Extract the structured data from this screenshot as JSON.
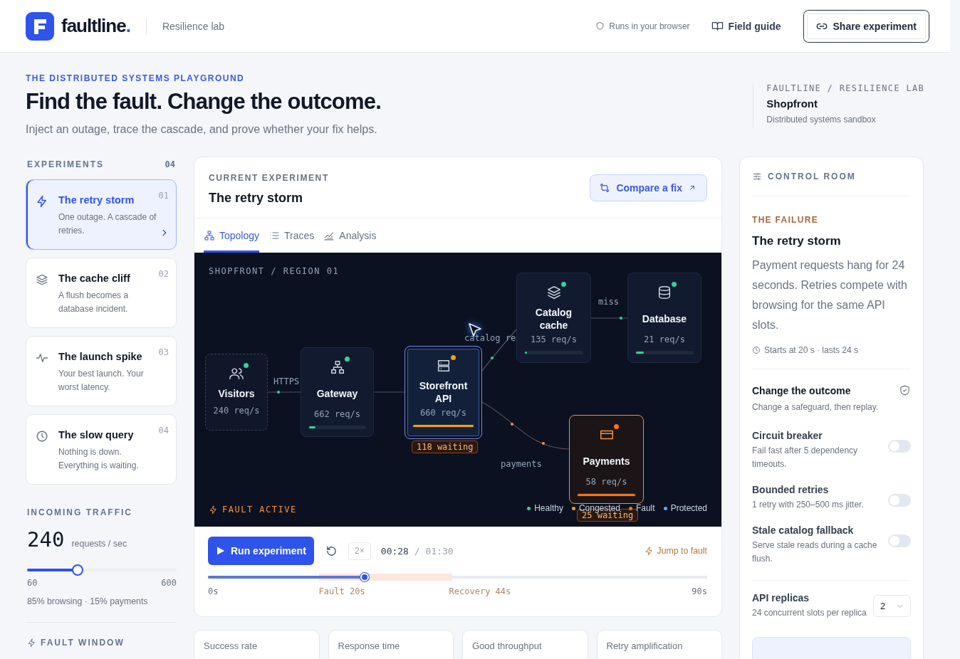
{
  "header": {
    "brand": {
      "name": "faultline",
      "mark": "."
    },
    "subtitle": "Resilience lab",
    "badge": "Runs in your browser",
    "guide_link": "Field guide",
    "share_button": "Share experiment"
  },
  "hero": {
    "eyebrow": "THE DISTRIBUTED SYSTEMS PLAYGROUND",
    "title": "Find the fault. Change the outcome.",
    "subtitle": "Inject an outage, trace the cascade, and prove whether your fix helps.",
    "meta": {
      "path": "FAULTLINE / RESILIENCE LAB",
      "name": "Shopfront",
      "caption": "Distributed systems sandbox"
    }
  },
  "experiments": {
    "heading": "EXPERIMENTS",
    "count": "04",
    "items": [
      {
        "kind": "bolt",
        "title": "The retry storm",
        "description": "One outage. A cascade of retries.",
        "number": "01",
        "selected": true
      },
      {
        "kind": "layers",
        "title": "The cache cliff",
        "description": "A flush becomes a database incident.",
        "number": "02",
        "selected": false
      },
      {
        "kind": "pulse",
        "title": "The launch spike",
        "description": "Your best launch. Your worst latency.",
        "number": "03",
        "selected": false
      },
      {
        "kind": "clock",
        "title": "The slow query",
        "description": "Nothing is down. Everything is waiting.",
        "number": "04",
        "selected": false
      }
    ]
  },
  "traffic": {
    "heading": "INCOMING TRAFFIC",
    "value": "240",
    "unit": "requests / sec",
    "level": 0.34,
    "min": "60",
    "max": "600",
    "mix": "85% browsing · 15% payments"
  },
  "fault_window": {
    "heading": "FAULT WINDOW"
  },
  "experiment": {
    "eyebrow": "CURRENT EXPERIMENT",
    "title": "The retry storm",
    "compare_button": "Compare a fix",
    "tabs": [
      {
        "kind": "topology",
        "label": "Topology",
        "selected": true
      },
      {
        "kind": "list",
        "label": "Traces",
        "selected": false
      },
      {
        "kind": "chart",
        "label": "Analysis",
        "selected": false
      }
    ]
  },
  "topology": {
    "region": "SHOPFRONT / REGION 01",
    "nodes": [
      {
        "kind": "visitors",
        "name": "Visitors",
        "rate": "240 req/s",
        "color": "#34d399",
        "faulted": false,
        "selected": false
      },
      {
        "kind": "gateway",
        "name": "Gateway",
        "rate": "662 req/s",
        "color": "#34d399",
        "faulted": false,
        "level": 0.12,
        "selected": false
      },
      {
        "kind": "server",
        "name": "Storefront API",
        "rate": "660 req/s",
        "color": "#f59e0b",
        "faulted": false,
        "level": 1,
        "selected": true,
        "waiting": "118 waiting"
      },
      {
        "kind": "cache",
        "name": "Catalog cache",
        "rate": "135 req/s",
        "color": "#34d399",
        "faulted": false,
        "level": 0.04,
        "selected": false
      },
      {
        "kind": "database",
        "name": "Database",
        "rate": "21 req/s",
        "color": "#34d399",
        "faulted": false,
        "level": 0.14,
        "selected": false
      },
      {
        "kind": "card",
        "name": "Payments",
        "rate": "58 req/s",
        "color": "#f97316",
        "faulted": true,
        "level": 1,
        "selected": false,
        "waiting": "25 waiting"
      }
    ],
    "edge_labels": [
      "HTTPS",
      "catalog re",
      "miss",
      "payments"
    ],
    "fault_badge": "FAULT ACTIVE",
    "legend": [
      {
        "label": "Healthy",
        "color": "#34d399"
      },
      {
        "label": "Congested",
        "color": "#f59e0b"
      },
      {
        "label": "Fault",
        "color": "#f97316"
      },
      {
        "label": "Protected",
        "color": "#60a5fa"
      }
    ]
  },
  "playback": {
    "run_button": "Run experiment",
    "speed": "2×",
    "elapsed": "00:28",
    "total": "/ 01:30",
    "jump": "Jump to fault",
    "level": 0.314,
    "markers": [
      "0s",
      "Fault 20s",
      "Recovery 44s",
      "90s"
    ]
  },
  "metrics": [
    "Success rate",
    "Response time",
    "Good throughput",
    "Retry amplification"
  ],
  "control_room": {
    "heading": "CONTROL ROOM",
    "failure": {
      "eyebrow": "THE FAILURE",
      "title": "The retry storm",
      "description": "Payment requests hang for 24 seconds. Retries compete with browsing for the same API slots.",
      "timing": "Starts at 20 s · lasts 24 s"
    },
    "outcome": {
      "title": "Change the outcome",
      "caption": "Change a safeguard, then replay."
    },
    "safeguards": [
      {
        "name": "Circuit breaker",
        "description": "Fail fast after 5 dependency timeouts.",
        "on": false
      },
      {
        "name": "Bounded retries",
        "description": "1 retry with 250–500 ms jitter.",
        "on": false
      },
      {
        "name": "Stale catalog fallback",
        "description": "Serve stale reads during a cache flush.",
        "on": false
      }
    ],
    "replicas": {
      "label": "API replicas",
      "caption": "24 concurrent slots per replica",
      "value": "2"
    }
  }
}
